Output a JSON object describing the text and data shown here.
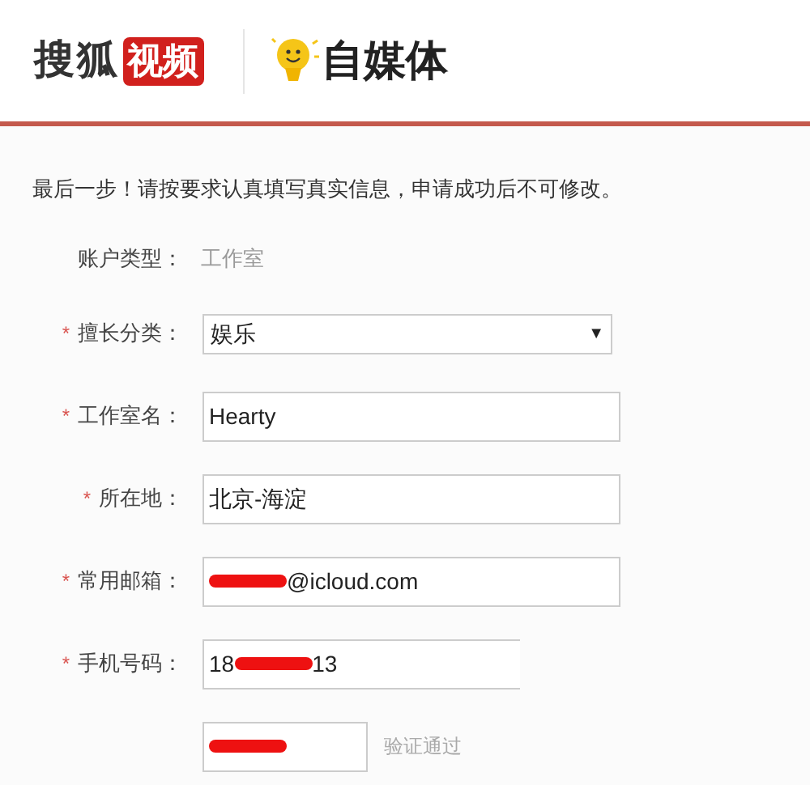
{
  "header": {
    "brand_left": "搜狐",
    "brand_badge": "视频",
    "brand_right": "自媒体"
  },
  "intro": "最后一步！请按要求认真填写真实信息，申请成功后不可修改。",
  "fields": [
    {
      "kind": "static",
      "label": "账户类型：",
      "value": "工作室"
    },
    {
      "kind": "select",
      "required_mark": "*",
      "label": "擅长分类：",
      "value": "娱乐",
      "arrow": "▼"
    },
    {
      "kind": "input",
      "required_mark": "*",
      "label": "工作室名：",
      "parts": [
        {
          "text": "Hearty"
        }
      ]
    },
    {
      "kind": "input",
      "required_mark": "*",
      "label": "所在地：",
      "parts": [
        {
          "text": "北京-海淀"
        }
      ]
    },
    {
      "kind": "input",
      "required_mark": "*",
      "label": "常用邮箱：",
      "parts": [
        {
          "kind": "redaction"
        },
        {
          "text": "@icloud.com"
        }
      ]
    },
    {
      "kind": "phone",
      "required_mark": "*",
      "label": "手机号码：",
      "parts": [
        {
          "text": "18"
        },
        {
          "kind": "redaction"
        },
        {
          "text": "13"
        }
      ]
    },
    {
      "kind": "code",
      "parts": [
        {
          "kind": "redaction"
        }
      ],
      "status": "验证通过"
    }
  ]
}
